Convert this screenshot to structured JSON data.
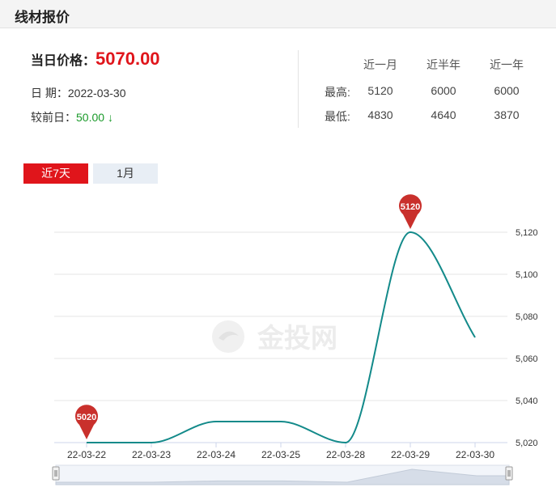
{
  "header": {
    "title": "线材报价"
  },
  "price": {
    "label": "当日价格：",
    "value": "5070.00"
  },
  "date": {
    "label": "日 期：",
    "value": "2022-03-30"
  },
  "change": {
    "label": "较前日：",
    "value": "50.00",
    "arrow": "↓"
  },
  "stats": {
    "headers": [
      "近一月",
      "近半年",
      "近一年"
    ],
    "rows": [
      {
        "label": "最高:",
        "values": [
          "5120",
          "6000",
          "6000"
        ]
      },
      {
        "label": "最低:",
        "values": [
          "4830",
          "4640",
          "3870"
        ]
      }
    ]
  },
  "tabs": [
    {
      "label": "近7天",
      "active": true
    },
    {
      "label": "1月",
      "active": false
    }
  ],
  "watermark": "金投网",
  "colors": {
    "accent": "#e0151b",
    "line": "#138a8a",
    "down": "#1a9a2a",
    "marker": "#c9302c"
  },
  "chart_data": {
    "type": "line",
    "categories": [
      "22-03-22",
      "22-03-23",
      "22-03-24",
      "22-03-25",
      "22-03-28",
      "22-03-29",
      "22-03-30"
    ],
    "series": [
      {
        "values": [
          5020,
          5020,
          5030,
          5030,
          5020,
          5120,
          5070
        ]
      }
    ],
    "yticks": [
      "5,020",
      "5,040",
      "5,060",
      "5,080",
      "5,100",
      "5,120"
    ],
    "ylim": [
      5020,
      5120
    ],
    "axis_side": "right",
    "grid": true,
    "markers": [
      {
        "label": "5020",
        "index": 0
      },
      {
        "label": "5120",
        "index": 5
      }
    ],
    "title": "",
    "xlabel": "",
    "ylabel": ""
  }
}
